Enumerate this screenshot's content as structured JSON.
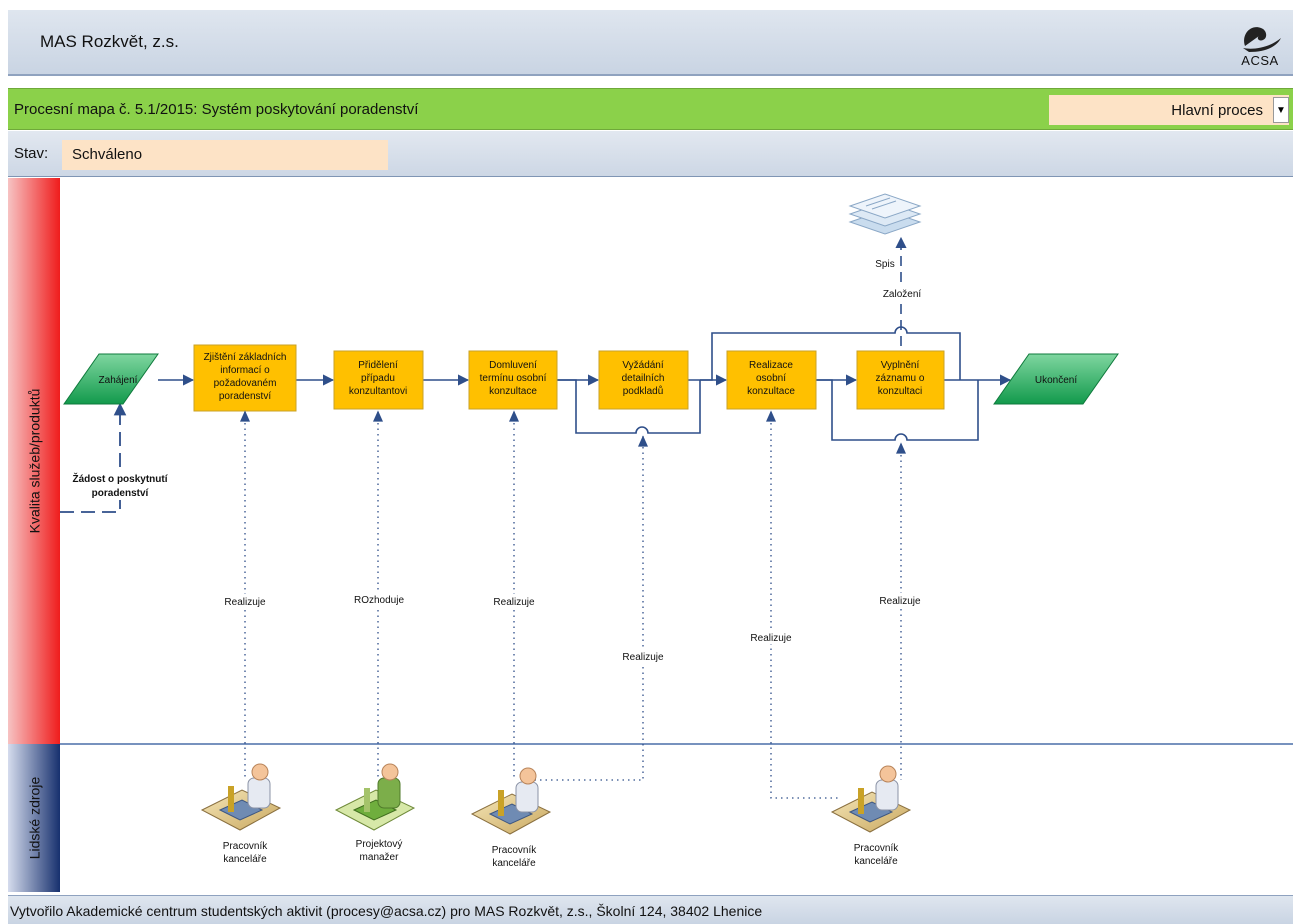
{
  "header": {
    "org_name": "MAS Rozkvět, z.s.",
    "logo_text": "ACSA"
  },
  "process_bar": {
    "title": "Procesní mapa č. 5.1/2015: Systém poskytování poradenství",
    "type_select": "Hlavní proces"
  },
  "status": {
    "label": "Stav:",
    "value": "Schváleno"
  },
  "lanes": {
    "top": "Kvalita služeb/produktů",
    "bottom": "Lidské zdroje"
  },
  "nodes": {
    "start": "Zahájení",
    "end": "Ukončení",
    "steps": [
      [
        "Zjištění základních",
        "informací o",
        "požadovaném",
        "poradenství"
      ],
      [
        "Přidělení",
        "případu",
        "konzultantovi"
      ],
      [
        "Domluvení",
        "termínu osobní",
        "konzultace"
      ],
      [
        "Vyžádání",
        "detailních",
        "podkladů"
      ],
      [
        "Realizace",
        "osobní",
        "konzultace"
      ],
      [
        "Vyplnění",
        "záznamu o",
        "konzultaci"
      ]
    ],
    "document": "Spis",
    "document_link": "Založení",
    "trigger": [
      "Žádost o poskytnutí",
      "poradenství"
    ]
  },
  "relations": [
    "Realizuje",
    "ROzhoduje",
    "Realizuje",
    "Realizuje",
    "Realizuje",
    "Realizuje"
  ],
  "roles": [
    [
      "Pracovník",
      "kanceláře"
    ],
    [
      "Projektový",
      "manažer"
    ],
    [
      "Pracovník",
      "kanceláře"
    ],
    [
      "Pracovník",
      "kanceláře"
    ]
  ],
  "footer": {
    "text": "Vytvořilo Akademické centrum studentských aktivit (procesy@acsa.cz) pro MAS Rozkvět, z.s., Školní 124, 38402 Lhenice"
  },
  "colors": {
    "step_fill": "#ffc000",
    "step_border": "#c9a227",
    "flow_line": "#2f4f8a",
    "green_bar": "#8bd14a",
    "status_fill": "#fde3c6"
  }
}
